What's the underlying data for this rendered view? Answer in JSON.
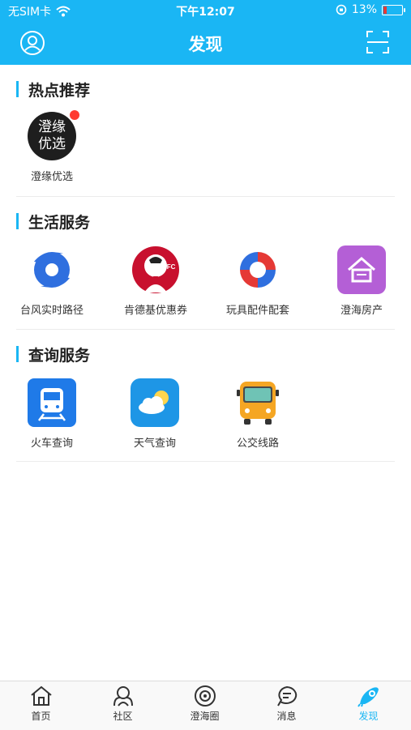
{
  "status": {
    "carrier": "无SIM卡",
    "time": "下午12:07",
    "battery": "13%"
  },
  "nav": {
    "title": "发现"
  },
  "sections": [
    {
      "title": "热点推荐",
      "items": [
        {
          "label": "澄缘优选",
          "icon_text": "澄缘\n优选",
          "icon": "chengyuan-logo",
          "badge": true
        }
      ]
    },
    {
      "title": "生活服务",
      "items": [
        {
          "label": "台风实时路径",
          "icon": "typhoon-icon"
        },
        {
          "label": "肯德基优惠券",
          "icon": "kfc-logo",
          "logo_text": "KFC"
        },
        {
          "label": "玩具配件配套",
          "icon": "toy-parts-logo"
        },
        {
          "label": "澄海房产",
          "icon": "house-icon"
        }
      ]
    },
    {
      "title": "查询服务",
      "items": [
        {
          "label": "火车查询",
          "icon": "train-icon"
        },
        {
          "label": "天气查询",
          "icon": "weather-icon"
        },
        {
          "label": "公交线路",
          "icon": "bus-icon"
        }
      ]
    }
  ],
  "tabs": [
    {
      "label": "首页",
      "icon": "home-icon"
    },
    {
      "label": "社区",
      "icon": "community-icon"
    },
    {
      "label": "澄海圈",
      "icon": "circle-icon"
    },
    {
      "label": "消息",
      "icon": "message-icon"
    },
    {
      "label": "发现",
      "icon": "discover-icon",
      "active": true
    }
  ],
  "colors": {
    "accent": "#1ab6f4",
    "badge": "#ff3b30"
  }
}
